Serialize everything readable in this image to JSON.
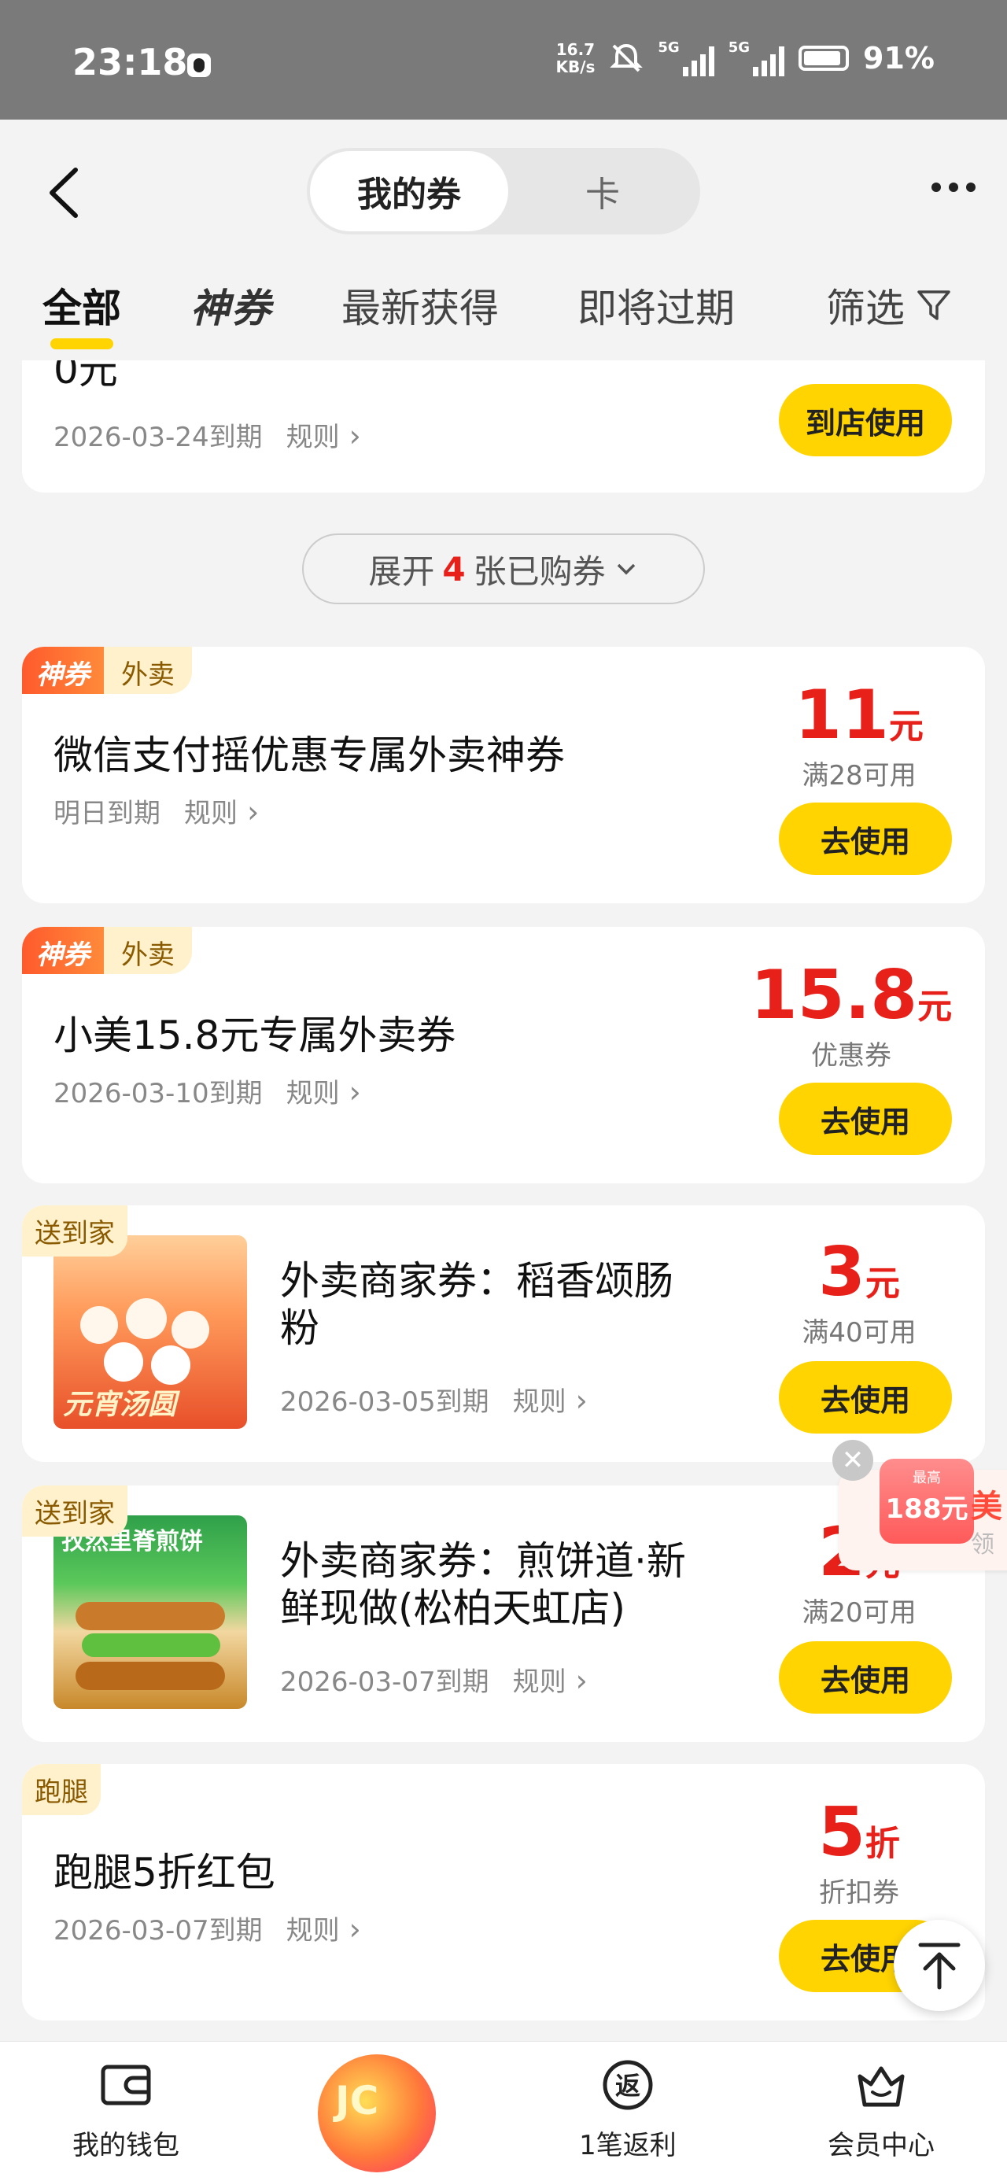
{
  "status_bar": {
    "time": "23:18",
    "speed_value": "16.7",
    "speed_unit": "KB/s",
    "net1": "5G",
    "net2": "5G",
    "battery": "91%"
  },
  "header": {
    "segment_active": "我的券",
    "segment_inactive": "卡"
  },
  "tabs": [
    {
      "label": "全部",
      "active": true
    },
    {
      "label": "神券",
      "active": false
    },
    {
      "label": "最新获得",
      "active": false
    },
    {
      "label": "即将过期",
      "active": false
    },
    {
      "label": "筛选",
      "active": false
    }
  ],
  "partial_card": {
    "title_partial": "0元",
    "expiry": "2026-03-24到期",
    "rules": "规则",
    "button": "到店使用"
  },
  "expand": {
    "prefix": "展开",
    "count": "4",
    "suffix": "张已购券"
  },
  "coupons": [
    {
      "tag_super": "神券",
      "tag_type": "外卖",
      "title": "微信支付摇优惠专属外卖神券",
      "expiry": "明日到期",
      "rules": "规则",
      "amount": "11",
      "unit": "元",
      "condition": "满28可用",
      "button": "去使用"
    },
    {
      "tag_super": "神券",
      "tag_type": "外卖",
      "title": "小美15.8元专属外卖券",
      "expiry": "2026-03-10到期",
      "rules": "规则",
      "amount": "15.8",
      "unit": "元",
      "condition": "优惠券",
      "button": "去使用"
    },
    {
      "tag_type": "送到家",
      "title_line1": "外卖商家券：稻香颂肠",
      "title_line2": "粉",
      "thumb_text": "元宵汤圆",
      "expiry": "2026-03-05到期",
      "rules": "规则",
      "amount": "3",
      "unit": "元",
      "condition": "满40可用",
      "button": "去使用"
    },
    {
      "tag_type": "送到家",
      "title_line1": "外卖商家券：煎饼道·新",
      "title_line2": "鲜现做(松柏天虹店)",
      "thumb_text": "孜然里脊煎饼",
      "expiry": "2026-03-07到期",
      "rules": "规则",
      "amount": "2",
      "unit": "元",
      "condition": "满20可用",
      "button": "去使用"
    },
    {
      "tag_type": "跑腿",
      "title": "跑腿5折红包",
      "expiry": "2026-03-07到期",
      "rules": "规则",
      "amount": "5",
      "unit": "折",
      "condition": "折扣券",
      "button": "去使用"
    }
  ],
  "float_widget": {
    "badge_top": "最高",
    "badge_value": "188元",
    "side_text": "美",
    "side_sub": "领"
  },
  "bottom_nav": [
    {
      "label": "我的钱包"
    },
    {
      "label": ""
    },
    {
      "label": "1笔返利"
    },
    {
      "label": "会员中心"
    }
  ],
  "center_ball_text": "JC"
}
